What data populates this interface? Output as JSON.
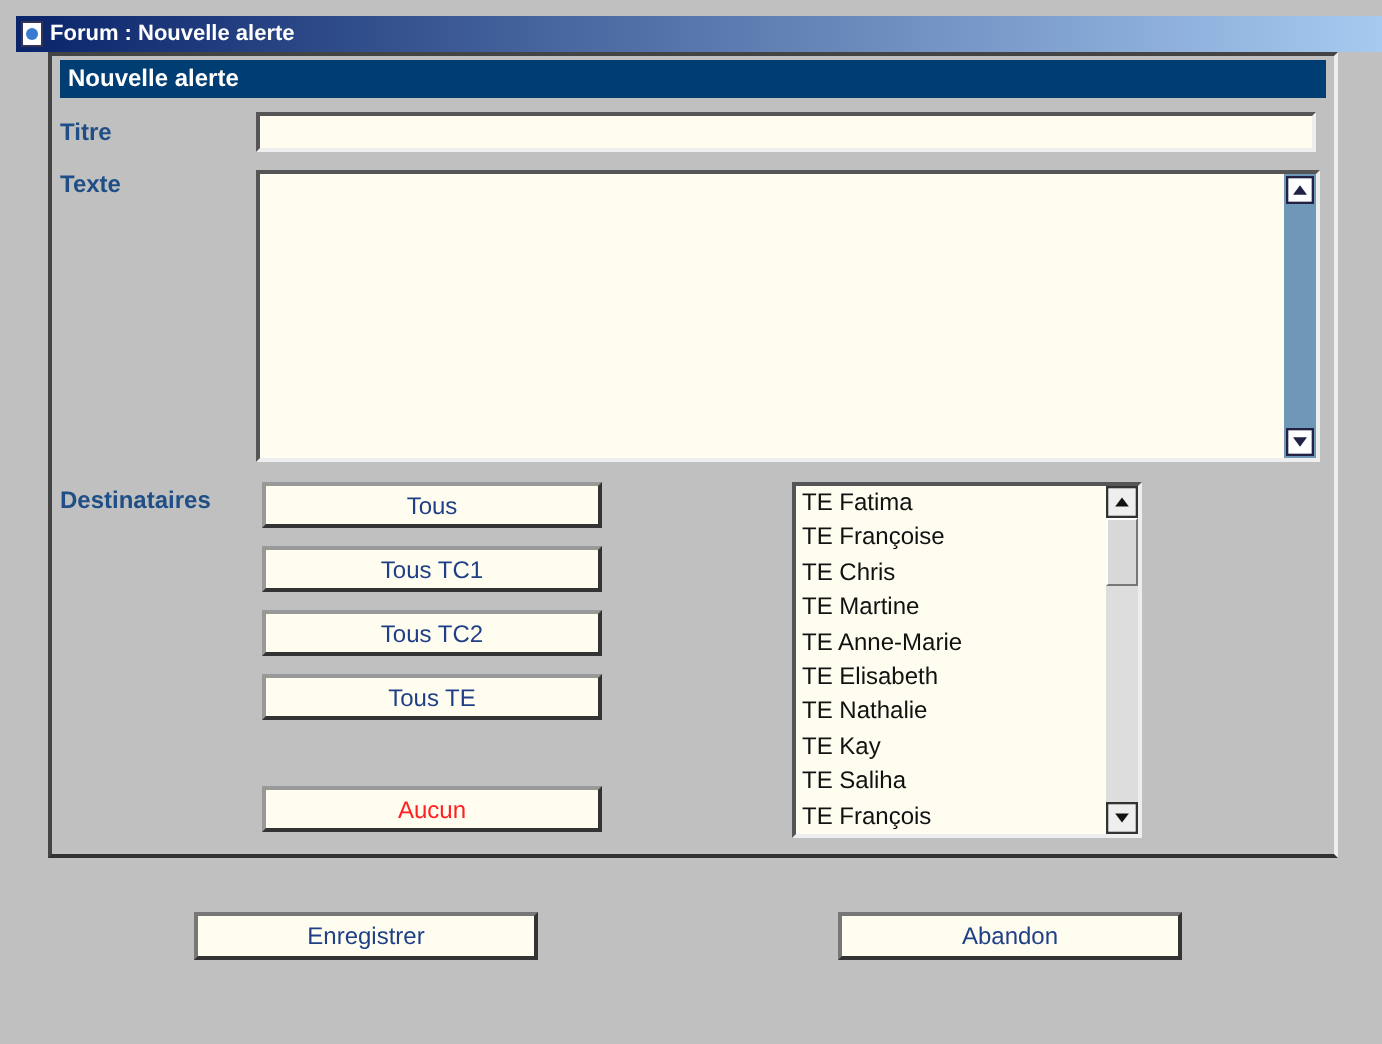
{
  "window": {
    "title": "Forum : Nouvelle alerte"
  },
  "panel": {
    "header": "Nouvelle alerte",
    "title_label": "Titre",
    "text_label": "Texte",
    "recipients_label": "Destinataires",
    "recipient_buttons": [
      {
        "label": "Tous",
        "color": "#1f3f86"
      },
      {
        "label": "Tous TC1",
        "color": "#1f3f86"
      },
      {
        "label": "Tous TC2",
        "color": "#1f3f86"
      },
      {
        "label": "Tous TE",
        "color": "#1f3f86"
      },
      {
        "label": "Aucun",
        "color": "#ff2020"
      }
    ],
    "recipients": [
      "TE Fatima",
      "TE Françoise",
      "TE Chris",
      "TE Martine",
      "TE Anne-Marie",
      "TE Elisabeth",
      "TE Nathalie",
      "TE Kay",
      "TE Saliha",
      "TE François"
    ]
  },
  "buttons": [
    "Enregistrer",
    "Abandon"
  ]
}
